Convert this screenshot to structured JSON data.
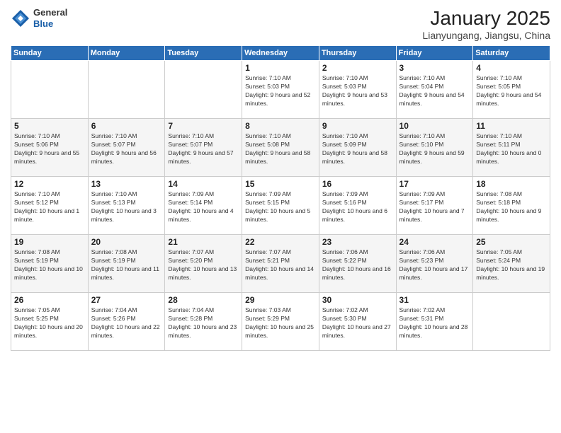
{
  "logo": {
    "general": "General",
    "blue": "Blue"
  },
  "header": {
    "title": "January 2025",
    "subtitle": "Lianyungang, Jiangsu, China"
  },
  "weekdays": [
    "Sunday",
    "Monday",
    "Tuesday",
    "Wednesday",
    "Thursday",
    "Friday",
    "Saturday"
  ],
  "weeks": [
    [
      {
        "day": "",
        "info": ""
      },
      {
        "day": "",
        "info": ""
      },
      {
        "day": "",
        "info": ""
      },
      {
        "day": "1",
        "info": "Sunrise: 7:10 AM\nSunset: 5:03 PM\nDaylight: 9 hours and 52 minutes."
      },
      {
        "day": "2",
        "info": "Sunrise: 7:10 AM\nSunset: 5:03 PM\nDaylight: 9 hours and 53 minutes."
      },
      {
        "day": "3",
        "info": "Sunrise: 7:10 AM\nSunset: 5:04 PM\nDaylight: 9 hours and 54 minutes."
      },
      {
        "day": "4",
        "info": "Sunrise: 7:10 AM\nSunset: 5:05 PM\nDaylight: 9 hours and 54 minutes."
      }
    ],
    [
      {
        "day": "5",
        "info": "Sunrise: 7:10 AM\nSunset: 5:06 PM\nDaylight: 9 hours and 55 minutes."
      },
      {
        "day": "6",
        "info": "Sunrise: 7:10 AM\nSunset: 5:07 PM\nDaylight: 9 hours and 56 minutes."
      },
      {
        "day": "7",
        "info": "Sunrise: 7:10 AM\nSunset: 5:07 PM\nDaylight: 9 hours and 57 minutes."
      },
      {
        "day": "8",
        "info": "Sunrise: 7:10 AM\nSunset: 5:08 PM\nDaylight: 9 hours and 58 minutes."
      },
      {
        "day": "9",
        "info": "Sunrise: 7:10 AM\nSunset: 5:09 PM\nDaylight: 9 hours and 58 minutes."
      },
      {
        "day": "10",
        "info": "Sunrise: 7:10 AM\nSunset: 5:10 PM\nDaylight: 9 hours and 59 minutes."
      },
      {
        "day": "11",
        "info": "Sunrise: 7:10 AM\nSunset: 5:11 PM\nDaylight: 10 hours and 0 minutes."
      }
    ],
    [
      {
        "day": "12",
        "info": "Sunrise: 7:10 AM\nSunset: 5:12 PM\nDaylight: 10 hours and 1 minute."
      },
      {
        "day": "13",
        "info": "Sunrise: 7:10 AM\nSunset: 5:13 PM\nDaylight: 10 hours and 3 minutes."
      },
      {
        "day": "14",
        "info": "Sunrise: 7:09 AM\nSunset: 5:14 PM\nDaylight: 10 hours and 4 minutes."
      },
      {
        "day": "15",
        "info": "Sunrise: 7:09 AM\nSunset: 5:15 PM\nDaylight: 10 hours and 5 minutes."
      },
      {
        "day": "16",
        "info": "Sunrise: 7:09 AM\nSunset: 5:16 PM\nDaylight: 10 hours and 6 minutes."
      },
      {
        "day": "17",
        "info": "Sunrise: 7:09 AM\nSunset: 5:17 PM\nDaylight: 10 hours and 7 minutes."
      },
      {
        "day": "18",
        "info": "Sunrise: 7:08 AM\nSunset: 5:18 PM\nDaylight: 10 hours and 9 minutes."
      }
    ],
    [
      {
        "day": "19",
        "info": "Sunrise: 7:08 AM\nSunset: 5:19 PM\nDaylight: 10 hours and 10 minutes."
      },
      {
        "day": "20",
        "info": "Sunrise: 7:08 AM\nSunset: 5:19 PM\nDaylight: 10 hours and 11 minutes."
      },
      {
        "day": "21",
        "info": "Sunrise: 7:07 AM\nSunset: 5:20 PM\nDaylight: 10 hours and 13 minutes."
      },
      {
        "day": "22",
        "info": "Sunrise: 7:07 AM\nSunset: 5:21 PM\nDaylight: 10 hours and 14 minutes."
      },
      {
        "day": "23",
        "info": "Sunrise: 7:06 AM\nSunset: 5:22 PM\nDaylight: 10 hours and 16 minutes."
      },
      {
        "day": "24",
        "info": "Sunrise: 7:06 AM\nSunset: 5:23 PM\nDaylight: 10 hours and 17 minutes."
      },
      {
        "day": "25",
        "info": "Sunrise: 7:05 AM\nSunset: 5:24 PM\nDaylight: 10 hours and 19 minutes."
      }
    ],
    [
      {
        "day": "26",
        "info": "Sunrise: 7:05 AM\nSunset: 5:25 PM\nDaylight: 10 hours and 20 minutes."
      },
      {
        "day": "27",
        "info": "Sunrise: 7:04 AM\nSunset: 5:26 PM\nDaylight: 10 hours and 22 minutes."
      },
      {
        "day": "28",
        "info": "Sunrise: 7:04 AM\nSunset: 5:28 PM\nDaylight: 10 hours and 23 minutes."
      },
      {
        "day": "29",
        "info": "Sunrise: 7:03 AM\nSunset: 5:29 PM\nDaylight: 10 hours and 25 minutes."
      },
      {
        "day": "30",
        "info": "Sunrise: 7:02 AM\nSunset: 5:30 PM\nDaylight: 10 hours and 27 minutes."
      },
      {
        "day": "31",
        "info": "Sunrise: 7:02 AM\nSunset: 5:31 PM\nDaylight: 10 hours and 28 minutes."
      },
      {
        "day": "",
        "info": ""
      }
    ]
  ]
}
